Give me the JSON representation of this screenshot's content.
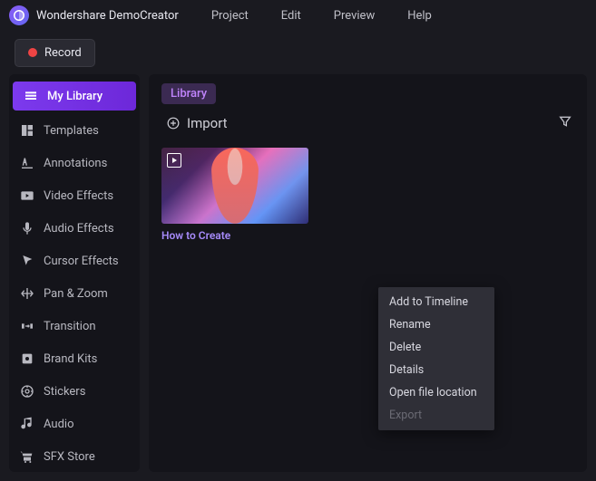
{
  "app": {
    "title": "Wondershare DemoCreator"
  },
  "menu": [
    "Project",
    "Edit",
    "Preview",
    "Help"
  ],
  "record_label": "Record",
  "sidebar": [
    {
      "label": "My Library",
      "icon": "library",
      "active": true
    },
    {
      "label": "Templates",
      "icon": "templates"
    },
    {
      "label": "Annotations",
      "icon": "annotations"
    },
    {
      "label": "Video Effects",
      "icon": "video-effects"
    },
    {
      "label": "Audio Effects",
      "icon": "audio-effects"
    },
    {
      "label": "Cursor Effects",
      "icon": "cursor-effects"
    },
    {
      "label": "Pan & Zoom",
      "icon": "pan-zoom"
    },
    {
      "label": "Transition",
      "icon": "transition"
    },
    {
      "label": "Brand Kits",
      "icon": "brand-kits"
    },
    {
      "label": "Stickers",
      "icon": "stickers"
    },
    {
      "label": "Audio",
      "icon": "audio"
    },
    {
      "label": "SFX Store",
      "icon": "sfx-store"
    }
  ],
  "content": {
    "tab_label": "Library",
    "import_label": "Import",
    "thumbnail_label": "How to Create"
  },
  "context_menu": [
    {
      "label": "Add to Timeline",
      "disabled": false
    },
    {
      "label": "Rename",
      "disabled": false
    },
    {
      "label": "Delete",
      "disabled": false
    },
    {
      "label": "Details",
      "disabled": false
    },
    {
      "label": "Open file location",
      "disabled": false
    },
    {
      "label": "Export",
      "disabled": true
    }
  ]
}
